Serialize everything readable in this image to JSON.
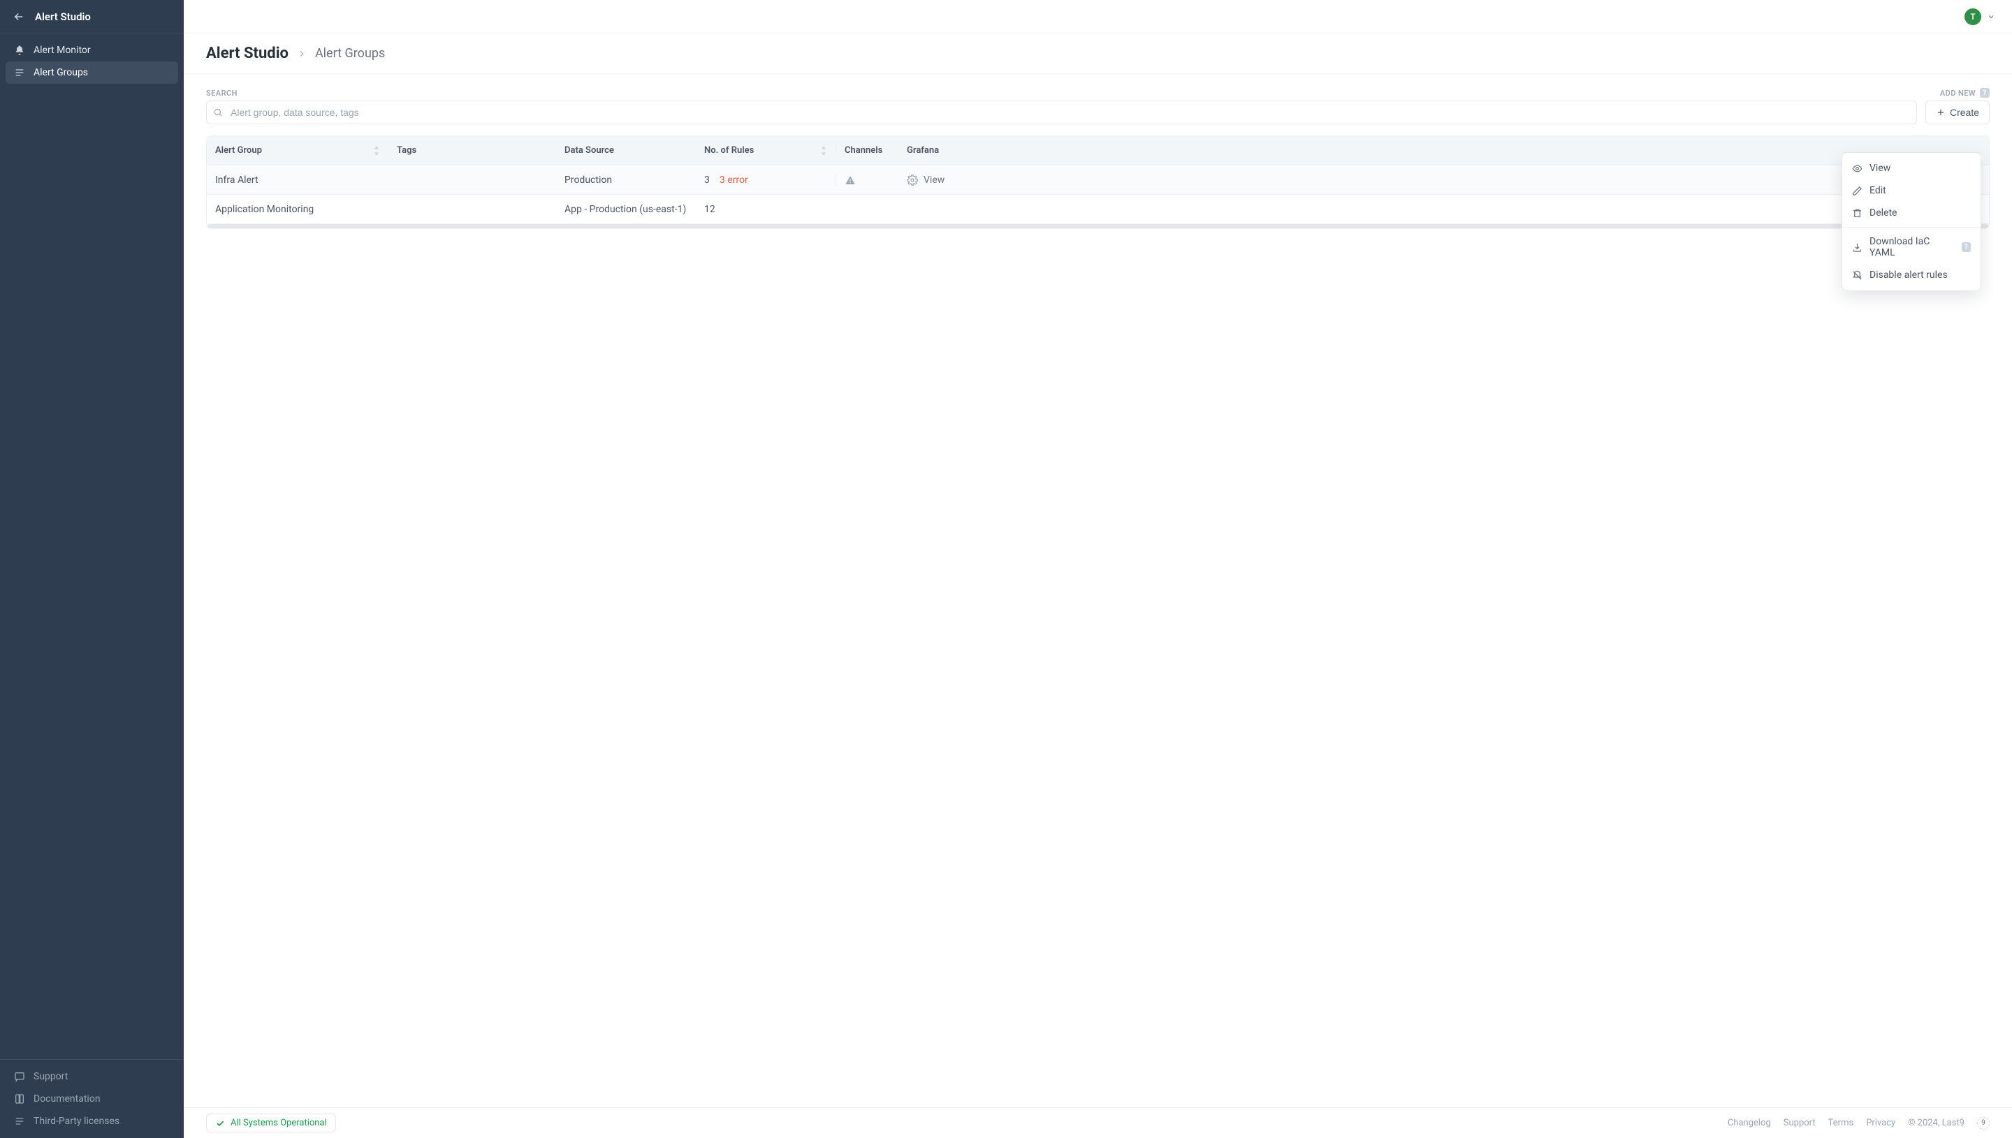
{
  "sidebar": {
    "title": "Alert Studio",
    "nav": [
      {
        "label": "Alert Monitor",
        "active": false
      },
      {
        "label": "Alert Groups",
        "active": true
      }
    ],
    "footer": [
      {
        "label": "Support"
      },
      {
        "label": "Documentation"
      },
      {
        "label": "Third-Party licenses"
      }
    ]
  },
  "topbar": {
    "avatar_initial": "T"
  },
  "breadcrumb": {
    "main": "Alert Studio",
    "sub": "Alert Groups"
  },
  "toolbar": {
    "search_label": "SEARCH",
    "search_placeholder": "Alert group, data source, tags",
    "addnew_label": "ADD NEW",
    "create_label": "Create"
  },
  "table": {
    "columns": {
      "group": "Alert Group",
      "tags": "Tags",
      "ds": "Data Source",
      "rules": "No. of Rules",
      "channels": "Channels",
      "grafana": "Grafana"
    },
    "rows": [
      {
        "group": "Infra Alert",
        "tags": "",
        "ds": "Production",
        "rules": "3",
        "rules_error": "3 error",
        "grafana_view": "View",
        "hovered": true,
        "has_channel_warning": true
      },
      {
        "group": "Application Monitoring",
        "tags": "",
        "ds": "App - Production (us-east-1)",
        "rules": "12",
        "rules_error": "",
        "grafana_view": "",
        "hovered": false,
        "has_channel_warning": false
      }
    ]
  },
  "ctx_menu": {
    "view": "View",
    "edit": "Edit",
    "delete": "Delete",
    "download": "Download IaC YAML",
    "disable": "Disable alert rules"
  },
  "footer": {
    "status": "All Systems Operational",
    "links": [
      "Changelog",
      "Support",
      "Terms",
      "Privacy"
    ],
    "copyright": "© 2024, Last9",
    "brand_glyph": "9"
  }
}
